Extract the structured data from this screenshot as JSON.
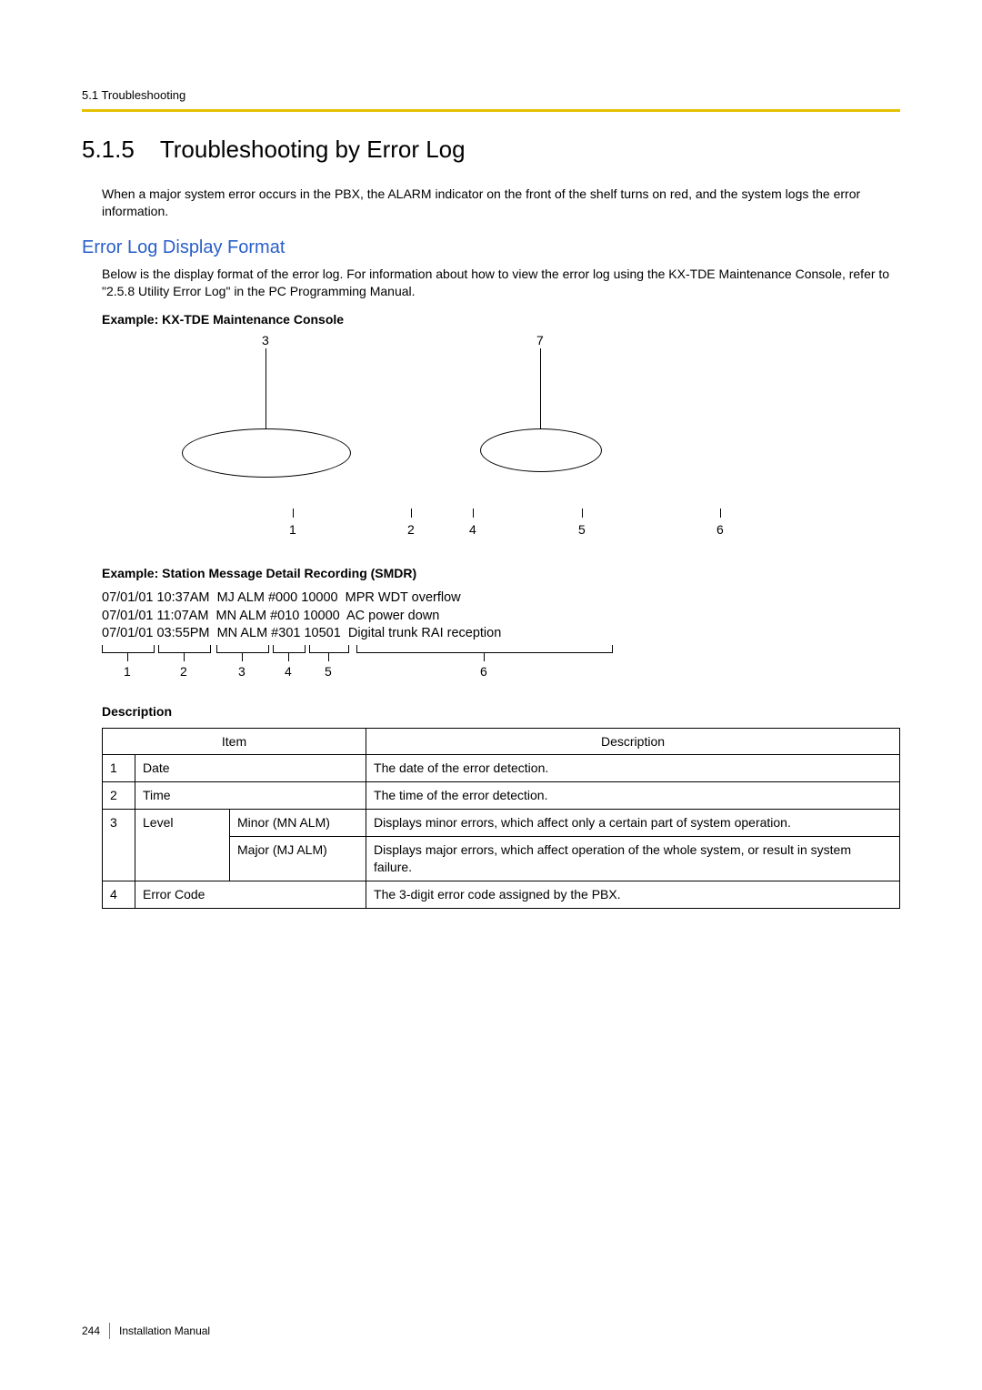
{
  "running_header": "5.1 Troubleshooting",
  "section": {
    "number": "5.1.5",
    "title": "Troubleshooting by Error Log"
  },
  "intro": "When a major system error occurs in the PBX, the ALARM indicator on the front of the shelf turns on red, and the system logs the error information.",
  "subheading": "Error Log Display Format",
  "sub_intro": "Below is the display format of the error log. For information about how to view the error log using the KX-TDE Maintenance Console, refer to \"2.5.8 Utility   Error Log\" in the PC Programming Manual.",
  "example1_label": "Example: KX-TDE Maintenance Console",
  "diagram": {
    "top_labels": {
      "left": "3",
      "right": "7"
    },
    "bottom_labels": [
      "1",
      "2",
      "4",
      "5",
      "6"
    ]
  },
  "example2_label": "Example: Station Message Detail Recording (SMDR)",
  "smdr_lines": [
    "07/01/01 10:37AM  MJ ALM #000 10000  MPR WDT overflow",
    "07/01/01 11:07AM  MN ALM #010 10000  AC power down",
    "07/01/01 03:55PM  MN ALM #301 10501  Digital trunk RAI reception"
  ],
  "smdr_bracket_labels": [
    "1",
    "2",
    "3",
    "4",
    "5",
    "6"
  ],
  "desc_heading": "Description",
  "table": {
    "headers": [
      "",
      "Item",
      "",
      "Description"
    ],
    "item_header": "Item",
    "desc_header": "Description",
    "rows": [
      {
        "n": "1",
        "item": "Date",
        "sub": "",
        "desc": "The date of the error detection."
      },
      {
        "n": "2",
        "item": "Time",
        "sub": "",
        "desc": "The time of the error detection."
      },
      {
        "n": "3",
        "item": "Level",
        "sub": "Minor (MN ALM)",
        "desc": "Displays minor errors, which affect only a certain part of system operation."
      },
      {
        "n": "",
        "item": "",
        "sub": "Major (MJ ALM)",
        "desc": "Displays major errors, which affect operation of the whole system, or result in system failure."
      },
      {
        "n": "4",
        "item": "Error Code",
        "sub": "",
        "desc": "The 3-digit error code assigned by the PBX."
      }
    ]
  },
  "footer": {
    "page": "244",
    "title": "Installation Manual"
  }
}
